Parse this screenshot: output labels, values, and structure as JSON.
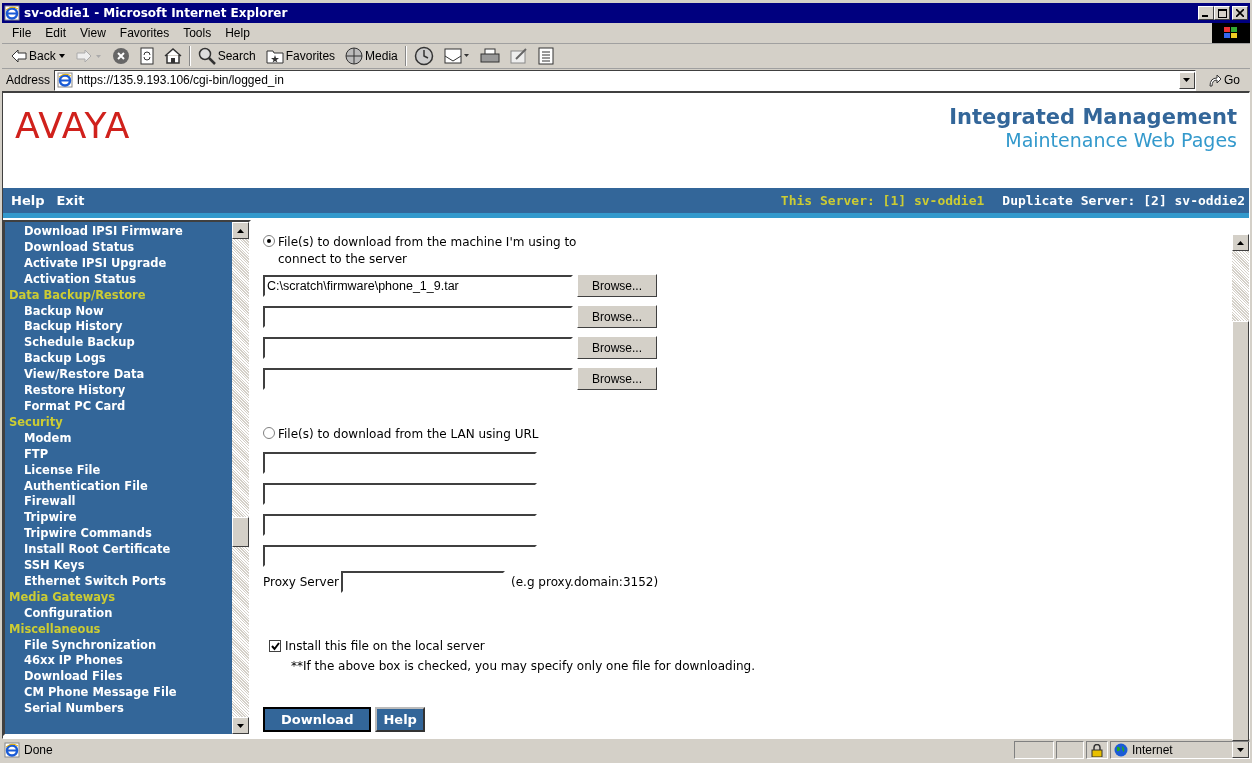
{
  "window": {
    "title": "sv-oddie1 - Microsoft Internet Explorer"
  },
  "menu_bar": [
    "File",
    "Edit",
    "View",
    "Favorites",
    "Tools",
    "Help"
  ],
  "toolbar": [
    {
      "kind": "back",
      "label": "Back"
    },
    {
      "kind": "forward"
    },
    {
      "kind": "stop"
    },
    {
      "kind": "refresh"
    },
    {
      "kind": "home"
    },
    {
      "kind": "search",
      "label": "Search"
    },
    {
      "kind": "favorites",
      "label": "Favorites"
    },
    {
      "kind": "media",
      "label": "Media"
    },
    {
      "kind": "history"
    },
    {
      "kind": "mail"
    },
    {
      "kind": "print"
    },
    {
      "kind": "edit"
    },
    {
      "kind": "discuss"
    }
  ],
  "address": {
    "label": "Address",
    "url": "https://135.9.193.106/cgi-bin/logged_in",
    "go": "Go"
  },
  "header": {
    "logo": "AVAYA",
    "title": "Integrated Management",
    "subtitle": "Maintenance Web Pages"
  },
  "nav": {
    "links": [
      "Help",
      "Exit"
    ],
    "this_server": "This Server: [1] sv-oddie1",
    "duplicate_server": "Duplicate Server: [2] sv-oddie2"
  },
  "sidebar": [
    {
      "kind": "link",
      "label": "Download IPSI Firmware"
    },
    {
      "kind": "link",
      "label": "Download Status"
    },
    {
      "kind": "link",
      "label": "Activate IPSI Upgrade"
    },
    {
      "kind": "link",
      "label": "Activation Status"
    },
    {
      "kind": "section",
      "label": "Data Backup/Restore"
    },
    {
      "kind": "link",
      "label": "Backup Now"
    },
    {
      "kind": "link",
      "label": "Backup History"
    },
    {
      "kind": "link",
      "label": "Schedule Backup"
    },
    {
      "kind": "link",
      "label": "Backup Logs"
    },
    {
      "kind": "link",
      "label": "View/Restore Data"
    },
    {
      "kind": "link",
      "label": "Restore History"
    },
    {
      "kind": "link",
      "label": "Format PC Card"
    },
    {
      "kind": "section",
      "label": "Security"
    },
    {
      "kind": "link",
      "label": "Modem"
    },
    {
      "kind": "link",
      "label": "FTP"
    },
    {
      "kind": "link",
      "label": "License File"
    },
    {
      "kind": "link",
      "label": "Authentication File"
    },
    {
      "kind": "link",
      "label": "Firewall"
    },
    {
      "kind": "link",
      "label": "Tripwire"
    },
    {
      "kind": "link",
      "label": "Tripwire Commands"
    },
    {
      "kind": "link",
      "label": "Install Root Certificate"
    },
    {
      "kind": "link",
      "label": "SSH Keys"
    },
    {
      "kind": "link",
      "label": "Ethernet Switch Ports"
    },
    {
      "kind": "section",
      "label": "Media Gateways"
    },
    {
      "kind": "link",
      "label": "Configuration"
    },
    {
      "kind": "section",
      "label": "Miscellaneous"
    },
    {
      "kind": "link",
      "label": "File Synchronization"
    },
    {
      "kind": "link",
      "label": "46xx IP Phones"
    },
    {
      "kind": "link",
      "label": "Download Files"
    },
    {
      "kind": "link",
      "label": "CM Phone Message File"
    },
    {
      "kind": "link",
      "label": "Serial Numbers"
    }
  ],
  "form": {
    "local_option": {
      "label": "File(s) to download from the machine I'm using to connect to the server",
      "selected": true
    },
    "file_inputs": [
      {
        "value": "C:\\scratch\\firmware\\phone_1_9.tar",
        "browse": "Browse..."
      },
      {
        "browse": "Browse..."
      },
      {
        "browse": "Browse..."
      },
      {
        "browse": "Browse..."
      }
    ],
    "lan_option": {
      "label": "File(s) to download from the LAN using URL",
      "selected": false
    },
    "proxy": {
      "label": "Proxy Server",
      "hint": "(e.g proxy.domain:3152)"
    },
    "install": {
      "label": "Install this file on the local server",
      "checked": true
    },
    "note": "**If the above box is checked, you may specify only one file for downloading.",
    "buttons": [
      "Download",
      "Help"
    ]
  },
  "status_bar": {
    "text": "Done",
    "zone": "Internet"
  }
}
